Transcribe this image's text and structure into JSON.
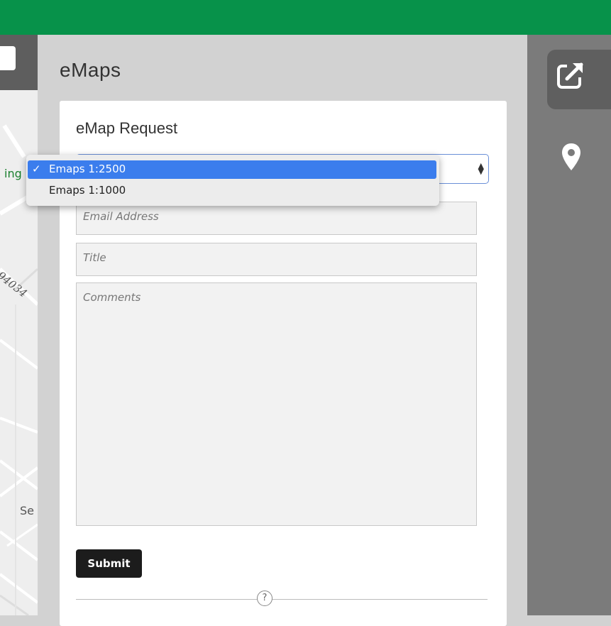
{
  "map": {
    "label_partial": "ing",
    "road_label": "94034",
    "street_label_partial": "Se"
  },
  "panel": {
    "title": "eMaps"
  },
  "form": {
    "title": "eMap Request",
    "scale_select": {
      "options": [
        "Emaps 1:2500",
        "Emaps 1:1000"
      ],
      "selected": "Emaps 1:2500",
      "check_mark": "✓"
    },
    "email_placeholder": "Email Address",
    "title_placeholder": "Title",
    "comments_placeholder": "Comments",
    "submit_label": "Submit",
    "help_glyph": "?"
  },
  "colors": {
    "top_bar": "#07924a",
    "selected_option": "#3b7ded",
    "toolbar": "#7b7b7b"
  },
  "toolbar": {
    "icons": [
      "export-edit-icon",
      "location-pin-icon"
    ]
  }
}
